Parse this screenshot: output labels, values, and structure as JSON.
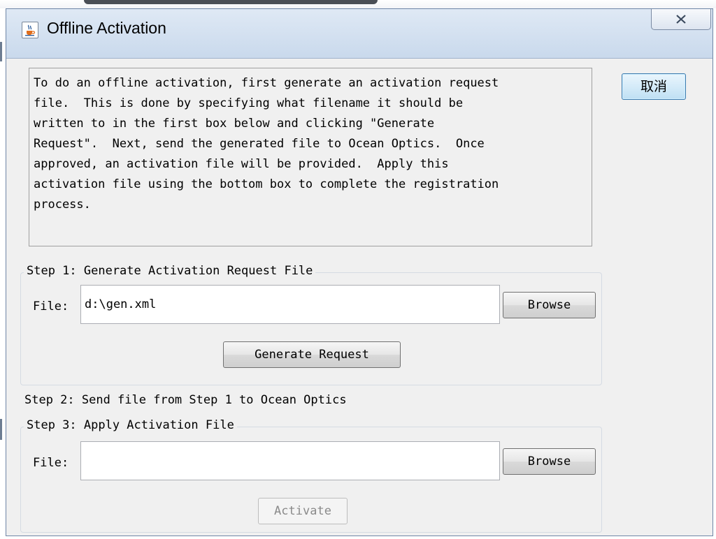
{
  "window": {
    "title": "Offline Activation"
  },
  "description": "To do an offline activation, first generate an activation request\nfile.  This is done by specifying what filename it should be\nwritten to in the first box below and clicking \"Generate\nRequest\".  Next, send the generated file to Ocean Optics.  Once\napproved, an activation file will be provided.  Apply this\nactivation file using the bottom box to complete the registration\nprocess.",
  "cancel_label": "取消",
  "step1": {
    "legend": "Step 1: Generate Activation Request File",
    "file_label": "File:",
    "file_value": "d:\\gen.xml",
    "browse_label": "Browse",
    "generate_label": "Generate Request"
  },
  "step2": {
    "text": "Step 2: Send file from Step 1 to Ocean Optics"
  },
  "step3": {
    "legend": "Step 3: Apply Activation File",
    "file_label": "File:",
    "file_value": "",
    "browse_label": "Browse",
    "activate_label": "Activate"
  }
}
